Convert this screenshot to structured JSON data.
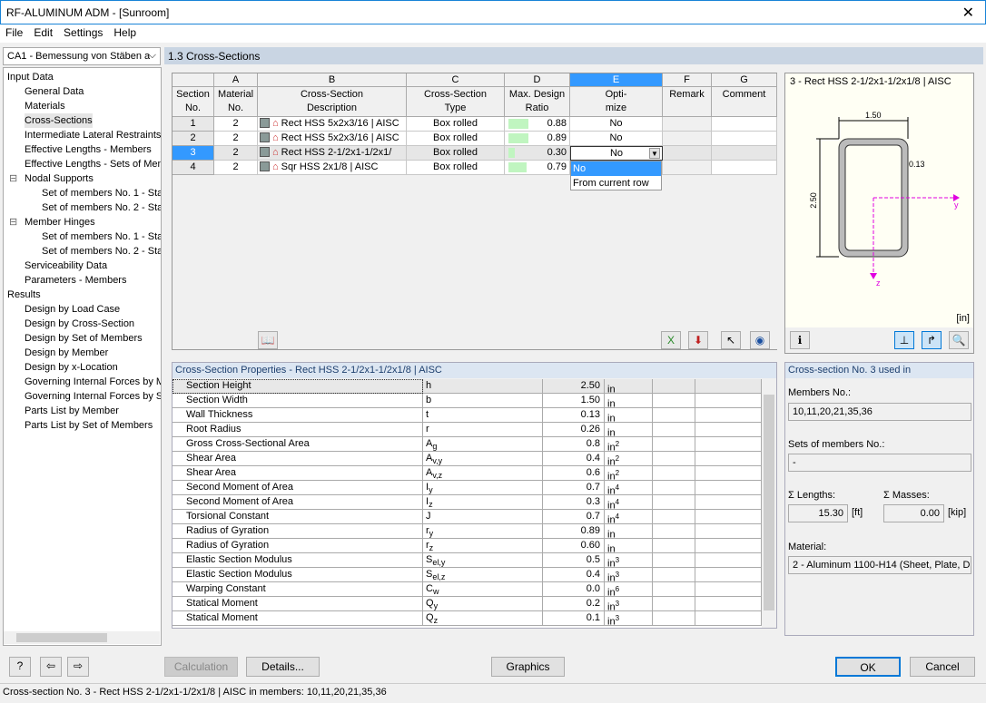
{
  "window": {
    "title": "RF-ALUMINUM ADM - [Sunroom]",
    "close": "✕"
  },
  "menu": [
    "File",
    "Edit",
    "Settings",
    "Help"
  ],
  "case_select": "CA1 - Bemessung von Stäben a",
  "tree": [
    {
      "label": "Input Data",
      "level": 0
    },
    {
      "label": "General Data",
      "level": 1
    },
    {
      "label": "Materials",
      "level": 1
    },
    {
      "label": "Cross-Sections",
      "level": 1,
      "selected": true
    },
    {
      "label": "Intermediate Lateral Restraints",
      "level": 1
    },
    {
      "label": "Effective Lengths - Members",
      "level": 1
    },
    {
      "label": "Effective Lengths - Sets of Mem",
      "level": 1
    },
    {
      "label": "Nodal Supports",
      "level": 1,
      "expander": "⊟"
    },
    {
      "label": "Set of members No. 1 - Sta",
      "level": 2
    },
    {
      "label": "Set of members No. 2 - Sta",
      "level": 2
    },
    {
      "label": "Member Hinges",
      "level": 1,
      "expander": "⊟"
    },
    {
      "label": "Set of members No. 1 - Sta",
      "level": 2
    },
    {
      "label": "Set of members No. 2 - Sta",
      "level": 2
    },
    {
      "label": "Serviceability Data",
      "level": 1
    },
    {
      "label": "Parameters - Members",
      "level": 1
    },
    {
      "label": "Results",
      "level": 0
    },
    {
      "label": "Design by Load Case",
      "level": 1
    },
    {
      "label": "Design by Cross-Section",
      "level": 1
    },
    {
      "label": "Design by Set of Members",
      "level": 1
    },
    {
      "label": "Design by Member",
      "level": 1
    },
    {
      "label": "Design by x-Location",
      "level": 1
    },
    {
      "label": "Governing Internal Forces by M",
      "level": 1
    },
    {
      "label": "Governing Internal Forces by S",
      "level": 1
    },
    {
      "label": "Parts List by Member",
      "level": 1
    },
    {
      "label": "Parts List by Set of Members",
      "level": 1
    }
  ],
  "section_title": "1.3 Cross-Sections",
  "table": {
    "letters": [
      "",
      "A",
      "B",
      "C",
      "D",
      "E",
      "F",
      "G"
    ],
    "headers": [
      [
        "Section",
        "No."
      ],
      [
        "Material",
        "No."
      ],
      [
        "Cross-Section",
        "Description"
      ],
      [
        "Cross-Section",
        "Type"
      ],
      [
        "Max. Design",
        "Ratio"
      ],
      [
        "Opti-",
        "mize"
      ],
      [
        "",
        "Remark"
      ],
      [
        "",
        "Comment"
      ]
    ],
    "rows": [
      {
        "no": "1",
        "mat": "2",
        "desc": "Rect HSS 5x2x3/16 | AISC",
        "type": "Box rolled",
        "ratio": 0.88,
        "ratio_text": "0.88",
        "opt": "No"
      },
      {
        "no": "2",
        "mat": "2",
        "desc": "Rect HSS 5x2x3/16 | AISC",
        "type": "Box rolled",
        "ratio": 0.89,
        "ratio_text": "0.89",
        "opt": "No"
      },
      {
        "no": "3",
        "mat": "2",
        "desc": "Rect HSS 2-1/2x1-1/2x1/",
        "type": "Box rolled",
        "ratio": 0.3,
        "ratio_text": "0.30",
        "opt": "No",
        "selected": true
      },
      {
        "no": "4",
        "mat": "2",
        "desc": "Sqr HSS 2x1/8 | AISC",
        "type": "Box rolled",
        "ratio": 0.79,
        "ratio_text": "0.79",
        "opt": ""
      }
    ],
    "dropdown_options": [
      "No",
      "From current row"
    ],
    "ratio_bar_color": "#c0f5c0",
    "selection_color": "#3399ff"
  },
  "graphic": {
    "title": "3 - Rect HSS 2-1/2x1-1/2x1/8 | AISC",
    "dim_b": "1.50",
    "dim_h": "2.50",
    "dim_t": "0.13",
    "axis_y": "y",
    "axis_z": "z",
    "unit": "[in]"
  },
  "props": {
    "title": "Cross-Section Properties  -  Rect HSS 2-1/2x1-1/2x1/8 | AISC",
    "rows": [
      {
        "name": "Section Height",
        "sym": "h",
        "sub": "",
        "val": "2.50",
        "unit": "in",
        "sup": ""
      },
      {
        "name": "Section Width",
        "sym": "b",
        "sub": "",
        "val": "1.50",
        "unit": "in",
        "sup": ""
      },
      {
        "name": "Wall Thickness",
        "sym": "t",
        "sub": "",
        "val": "0.13",
        "unit": "in",
        "sup": ""
      },
      {
        "name": "Root Radius",
        "sym": "r",
        "sub": "",
        "val": "0.26",
        "unit": "in",
        "sup": ""
      },
      {
        "name": "Gross Cross-Sectional Area",
        "sym": "A",
        "sub": "g",
        "val": "0.8",
        "unit": "in",
        "sup": "2"
      },
      {
        "name": "Shear Area",
        "sym": "A",
        "sub": "v,y",
        "val": "0.4",
        "unit": "in",
        "sup": "2"
      },
      {
        "name": "Shear Area",
        "sym": "A",
        "sub": "v,z",
        "val": "0.6",
        "unit": "in",
        "sup": "2"
      },
      {
        "name": "Second Moment of Area",
        "sym": "I",
        "sub": "y",
        "val": "0.7",
        "unit": "in",
        "sup": "4"
      },
      {
        "name": "Second Moment of Area",
        "sym": "I",
        "sub": "z",
        "val": "0.3",
        "unit": "in",
        "sup": "4"
      },
      {
        "name": "Torsional Constant",
        "sym": "J",
        "sub": "",
        "val": "0.7",
        "unit": "in",
        "sup": "4"
      },
      {
        "name": "Radius of Gyration",
        "sym": "r",
        "sub": "y",
        "val": "0.89",
        "unit": "in",
        "sup": ""
      },
      {
        "name": "Radius of Gyration",
        "sym": "r",
        "sub": "z",
        "val": "0.60",
        "unit": "in",
        "sup": ""
      },
      {
        "name": "Elastic Section Modulus",
        "sym": "S",
        "sub": "el,y",
        "val": "0.5",
        "unit": "in",
        "sup": "3"
      },
      {
        "name": "Elastic Section Modulus",
        "sym": "S",
        "sub": "el,z",
        "val": "0.4",
        "unit": "in",
        "sup": "3"
      },
      {
        "name": "Warping Constant",
        "sym": "C",
        "sub": "w",
        "val": "0.0",
        "unit": "in",
        "sup": "6"
      },
      {
        "name": "Statical Moment",
        "sym": "Q",
        "sub": "y",
        "val": "0.2",
        "unit": "in",
        "sup": "3"
      },
      {
        "name": "Statical Moment",
        "sym": "Q",
        "sub": "z",
        "val": "0.1",
        "unit": "in",
        "sup": "3"
      }
    ]
  },
  "info": {
    "title": "Cross-section No. 3 used in",
    "members_label": "Members No.:",
    "members": "10,11,20,21,35,36",
    "sets_label": "Sets of members No.:",
    "sets": "-",
    "lengths_label": "Σ Lengths:",
    "lengths": "15.30",
    "lengths_unit": "[ft]",
    "masses_label": "Σ Masses:",
    "masses": "0.00",
    "masses_unit": "[kip]",
    "material_label": "Material:",
    "material": "2 - Aluminum 1100-H14 (Sheet, Plate, Dr"
  },
  "buttons": {
    "calculation": "Calculation",
    "details": "Details...",
    "graphics": "Graphics",
    "ok": "OK",
    "cancel": "Cancel"
  },
  "status": "Cross-section No. 3 - Rect HSS 2-1/2x1-1/2x1/8 | AISC in members: 10,11,20,21,35,36"
}
